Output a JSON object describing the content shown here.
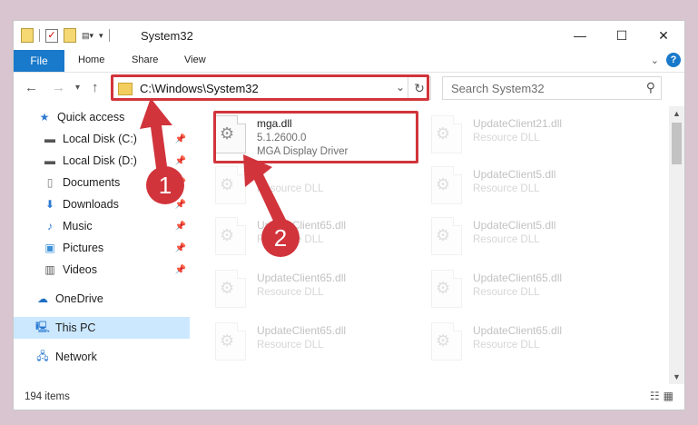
{
  "window": {
    "title": "System32",
    "controls": {
      "minimize": "—",
      "maximize": "☐",
      "close": "✕"
    }
  },
  "ribbon": {
    "file_tab": "File",
    "tabs": [
      "Home",
      "Share",
      "View"
    ],
    "help": "?"
  },
  "nav": {
    "address": "C:\\Windows\\System32",
    "search_placeholder": "Search System32"
  },
  "sidebar": {
    "items": [
      {
        "label": "Quick access",
        "icon": "star-icon",
        "pinned": false
      },
      {
        "label": "Local Disk (C:)",
        "icon": "drive-icon",
        "pinned": true
      },
      {
        "label": "Local Disk (D:)",
        "icon": "drive-icon",
        "pinned": true
      },
      {
        "label": "Documents",
        "icon": "document-icon",
        "pinned": true
      },
      {
        "label": "Downloads",
        "icon": "download-icon",
        "pinned": true
      },
      {
        "label": "Music",
        "icon": "music-icon",
        "pinned": true
      },
      {
        "label": "Pictures",
        "icon": "picture-icon",
        "pinned": true
      },
      {
        "label": "Videos",
        "icon": "video-icon",
        "pinned": true
      },
      {
        "label": "OneDrive",
        "icon": "cloud-icon",
        "pinned": false
      },
      {
        "label": "This PC",
        "icon": "computer-icon",
        "pinned": false,
        "selected": true
      },
      {
        "label": "Network",
        "icon": "network-icon",
        "pinned": false
      }
    ]
  },
  "files": {
    "highlighted": {
      "name": "mga.dll",
      "version": "5.1.2600.0",
      "description": "MGA Display Driver"
    },
    "left_column": [
      {
        "name": "",
        "description": "Resource DLL"
      },
      {
        "name": "UpdateClient65.dll",
        "description": "Resource DLL"
      },
      {
        "name": "UpdateClient65.dll",
        "description": "Resource DLL"
      },
      {
        "name": "UpdateClient65.dll",
        "description": "Resource DLL"
      }
    ],
    "right_column": [
      {
        "name": "UpdateClient21.dll",
        "description": "Resource DLL"
      },
      {
        "name": "UpdateClient5.dll",
        "description": "Resource DLL"
      },
      {
        "name": "UpdateClient5.dll",
        "description": "Resource DLL"
      },
      {
        "name": "UpdateClient65.dll",
        "description": "Resource DLL"
      },
      {
        "name": "UpdateClient65.dll",
        "description": "Resource DLL"
      }
    ]
  },
  "status": {
    "item_count": "194 items"
  },
  "annotations": {
    "step1": "1",
    "step2": "2",
    "color": "#d1343b"
  }
}
